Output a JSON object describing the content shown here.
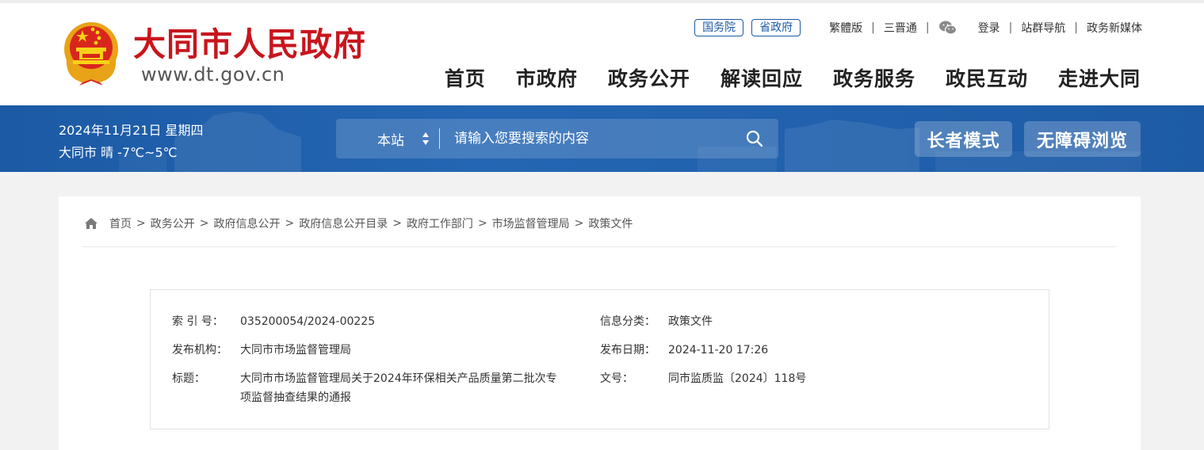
{
  "site": {
    "title": "大同市人民政府",
    "url": "www.dt.gov.cn"
  },
  "top_links": {
    "pill_state_council": "国务院",
    "pill_province": "省政府",
    "traditional": "繁體版",
    "sanjin": "三晋通",
    "login": "登录",
    "site_nav": "站群导航",
    "new_media": "政务新媒体",
    "separator": "|"
  },
  "main_nav": [
    "首页",
    "市政府",
    "政务公开",
    "解读回应",
    "政务服务",
    "政民互动",
    "走进大同"
  ],
  "banner": {
    "date": "2024年11月21日 星期四",
    "weather": "大同市 晴 -7℃~5℃",
    "scope": "本站",
    "search_placeholder": "请输入您要搜索的内容",
    "elder_mode": "长者模式",
    "accessible": "无障碍浏览"
  },
  "breadcrumb": [
    "首页",
    "政务公开",
    "政府信息公开",
    "政府信息公开目录",
    "政府工作部门",
    "市场监督管理局",
    "政策文件"
  ],
  "breadcrumb_sep": ">",
  "meta": {
    "index_label": "索 引 号：",
    "index_value": "035200054/2024-00225",
    "category_label": "信息分类：",
    "category_value": "政策文件",
    "publisher_label": "发布机构：",
    "publisher_value": "大同市市场监督管理局",
    "date_label": "发布日期：",
    "date_value": "2024-11-20 17:26",
    "title_label": "标题：",
    "title_value_line1": "大同市市场监督管理局关于2024年环保相关产品质量第二批次专",
    "title_value_line2": "项监督抽查结果的通报",
    "docno_label": "文号：",
    "docno_value": "同市监质监〔2024〕118号"
  },
  "colors": {
    "brand_red": "#c8161d",
    "banner_blue": "#1c5aa5",
    "pill_blue": "#1b5aa6"
  },
  "icons": [
    "national-emblem-icon",
    "wechat-icon",
    "search-icon",
    "home-icon",
    "sort-arrows-icon"
  ]
}
